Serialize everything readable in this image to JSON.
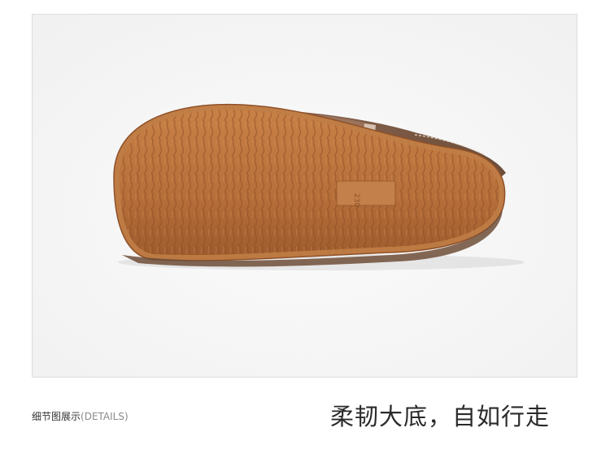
{
  "product_image": {
    "icon": "shoe-outsole-photo",
    "size_stamp": "230",
    "colors": {
      "sole": "#b9743f",
      "sole_edge": "#9a5a2e",
      "upper": "#7a5a44",
      "background": "#f7f7f7"
    }
  },
  "caption": {
    "label": "细节图展示",
    "sublabel": "(DETAILS)"
  },
  "headline": "柔韧大底，自如行走"
}
